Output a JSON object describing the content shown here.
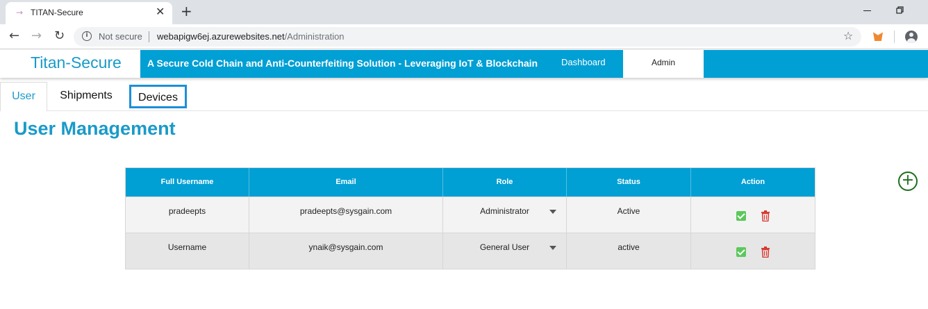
{
  "browser": {
    "tab_title": "TITAN-Secure",
    "tab_close": "✕",
    "new_tab": "+",
    "security_label": "Not secure",
    "url_host": "webapigw6ej.azurewebsites.net",
    "url_path": "/Administration"
  },
  "header": {
    "brand": "Titan-Secure",
    "tagline": "A Secure Cold Chain and Anti-Counterfeiting Solution - Leveraging IoT & Blockchain",
    "nav": {
      "dashboard": "Dashboard",
      "admin": "Admin"
    }
  },
  "subtabs": {
    "user": "User",
    "shipments": "Shipments",
    "devices": "Devices"
  },
  "page": {
    "title": "User Management"
  },
  "table": {
    "columns": [
      "Full Username",
      "Email",
      "Role",
      "Status",
      "Action"
    ],
    "rows": [
      {
        "username": "pradeepts",
        "email": "pradeepts@sysgain.com",
        "role": "Administrator",
        "status": "Active"
      },
      {
        "username": "Username",
        "email": "ynaik@sysgain.com",
        "role": "General User",
        "status": "active"
      }
    ]
  },
  "colors": {
    "accent": "#009fd4",
    "brand_text": "#1a9ac9",
    "confirm_green": "#5cc85c",
    "delete_red": "#d9342b",
    "add_green": "#1e6e1e"
  },
  "icons": [
    "info-icon",
    "star-icon",
    "extension-icon",
    "profile-icon",
    "add-icon",
    "check-icon",
    "trash-icon",
    "caret-down-icon"
  ]
}
